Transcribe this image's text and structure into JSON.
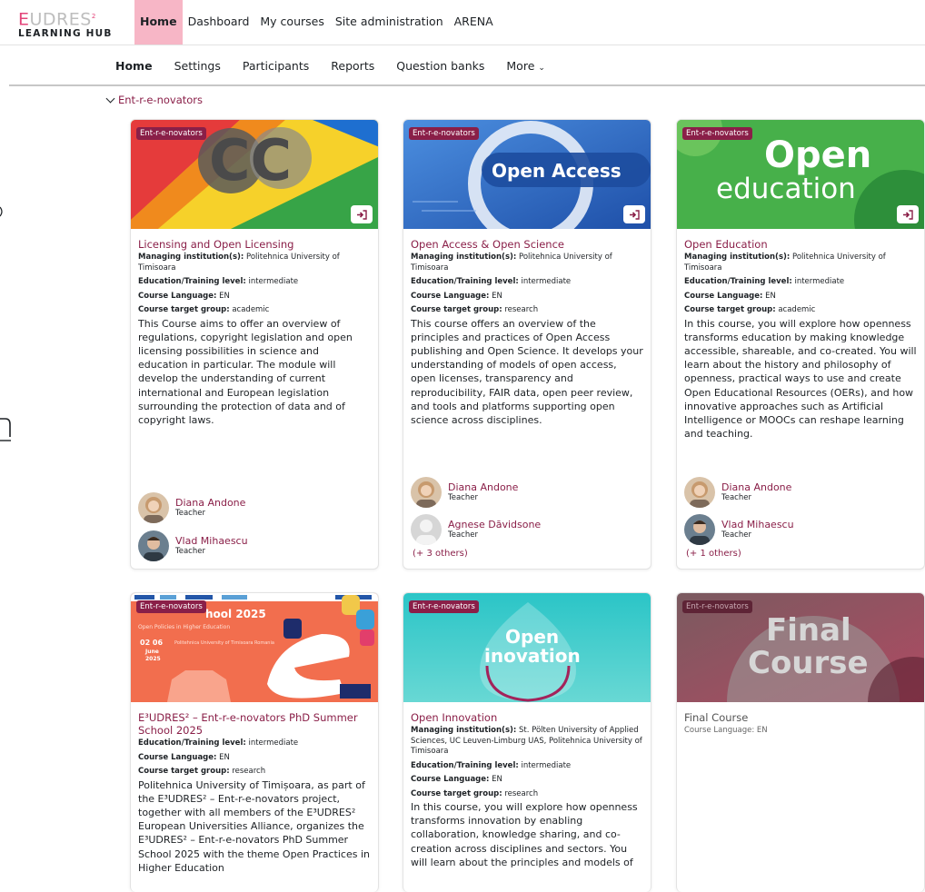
{
  "brand": {
    "line1_accent": "E",
    "line1_rest": "UDRES",
    "line2": "LEARNING HUB"
  },
  "topnav": [
    "Home",
    "Dashboard",
    "My courses",
    "Site administration",
    "ARENA"
  ],
  "secnav": [
    "Home",
    "Settings",
    "Participants",
    "Reports",
    "Question banks",
    "More"
  ],
  "section": {
    "title": "Ent-r-e-novators"
  },
  "badge_label": "Ent-r-e-novators",
  "labels": {
    "institution": "Managing institution(s):",
    "level": "Education/Training level:",
    "language": "Course Language:",
    "target": "Course target group:",
    "teacher_role": "Teacher"
  },
  "colors": {
    "accent": "#8a1f48",
    "home_highlight": "#f7b6c6"
  },
  "courses": [
    {
      "title": "Licensing and Open Licensing",
      "image_text": "CC",
      "institution": "Politehnica University of Timisoara",
      "level": "intermediate",
      "language": "EN",
      "target": "academic",
      "description": "This Course aims to offer an overview of regulations, copyright legislation and open licensing possibilities in science and education in particular. The module will develop the understanding of current international and European legislation surrounding the protection of data and of copyright laws.",
      "teachers": [
        {
          "name": "Diana Andone"
        },
        {
          "name": "Vlad Mihaescu"
        }
      ]
    },
    {
      "title": "Open Access & Open Science",
      "image_text": "Open Access",
      "institution": "Politehnica University of Timisoara",
      "level": "intermediate",
      "language": "EN",
      "target": "research",
      "description": "This course offers an overview of the principles and practices of Open Access publishing and Open Science. It develops your understanding of models of open access, open licenses, transparency and reproducibility, FAIR data, open peer review, and tools and platforms supporting open science across disciplines.",
      "teachers": [
        {
          "name": "Diana Andone"
        },
        {
          "name": "Agnese Dāvidsone"
        }
      ],
      "others": "(+ 3 others)"
    },
    {
      "title": "Open Education",
      "image_text_1": "Open",
      "image_text_2": "education",
      "institution": "Politehnica University of Timisoara",
      "level": "intermediate",
      "language": "EN",
      "target": "academic",
      "description": "In this course, you will explore how openness transforms education by making knowledge accessible, shareable, and co-created. You will learn about the history and philosophy of openness, practical ways to use and create Open Educational Resources (OERs), and how innovative approaches such as Artificial Intelligence or MOOCs can reshape learning and teaching.",
      "teachers": [
        {
          "name": "Diana Andone"
        },
        {
          "name": "Vlad Mihaescu"
        }
      ],
      "others": "(+ 1 others)"
    },
    {
      "title": "E³UDRES² – Ent-r-e-novators PhD Summer School 2025",
      "image_text_1": "hool 2025",
      "image_text_2": "Open Policies in Higher Education",
      "image_text_3": "02  06",
      "image_text_4": "June",
      "image_text_5": "2025",
      "image_text_6": "Politehnica University of Timisoara Romania",
      "level": "intermediate",
      "language": "EN",
      "target": "research",
      "description": "Politehnica University of Timișoara, as part of the E³UDRES² – Ent-r-e-novators project, together with all members of the E³UDRES² European Universities Alliance, organizes the E³UDRES² – Ent-r-e-novators PhD Summer School 2025 with the theme Open Practices in Higher Education"
    },
    {
      "title": "Open Innovation",
      "image_text_1": "Open",
      "image_text_2": "inovation",
      "institution": "St. Pölten University of Applied Sciences, UC Leuven-Limburg UAS, Politehnica University of Timisoara",
      "level": "intermediate",
      "language": "EN",
      "target": "research",
      "description": "In this course, you will explore how openness transforms innovation by enabling collaboration, knowledge sharing, and co-creation across disciplines and sectors. You will learn about the principles and models of"
    },
    {
      "title": "Final Course",
      "image_text_1": "Final",
      "image_text_2": "Course",
      "language": "EN"
    }
  ]
}
